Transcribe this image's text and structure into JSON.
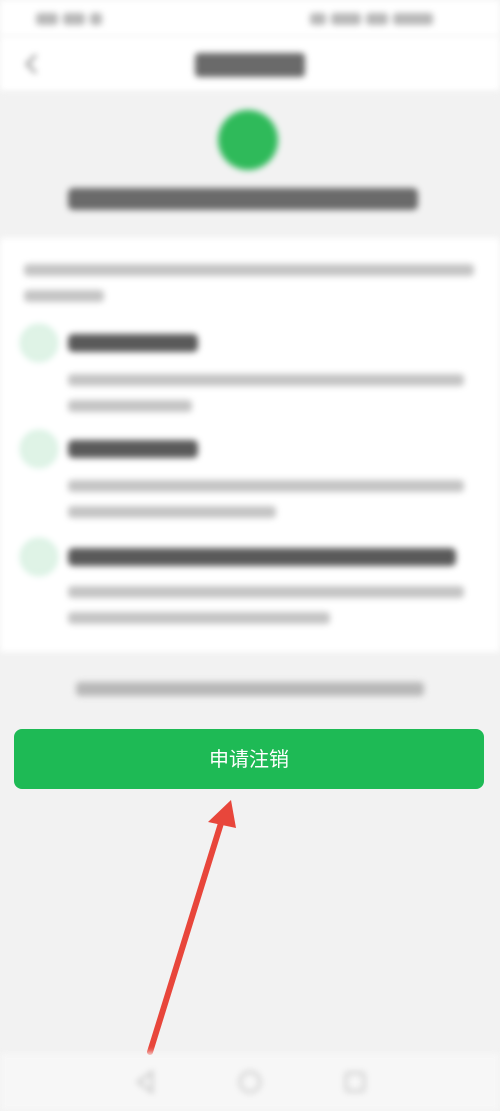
{
  "account_cancel": {
    "apply_button_label": "申请注销"
  },
  "colors": {
    "primary_green": "#1eba55",
    "annotation_arrow": "#e8463b"
  },
  "icons": {
    "back": "chevron-left-icon",
    "hero": "account-icon",
    "nav_back": "triangle-back-icon",
    "nav_home": "circle-home-icon",
    "nav_recent": "square-recent-icon"
  }
}
